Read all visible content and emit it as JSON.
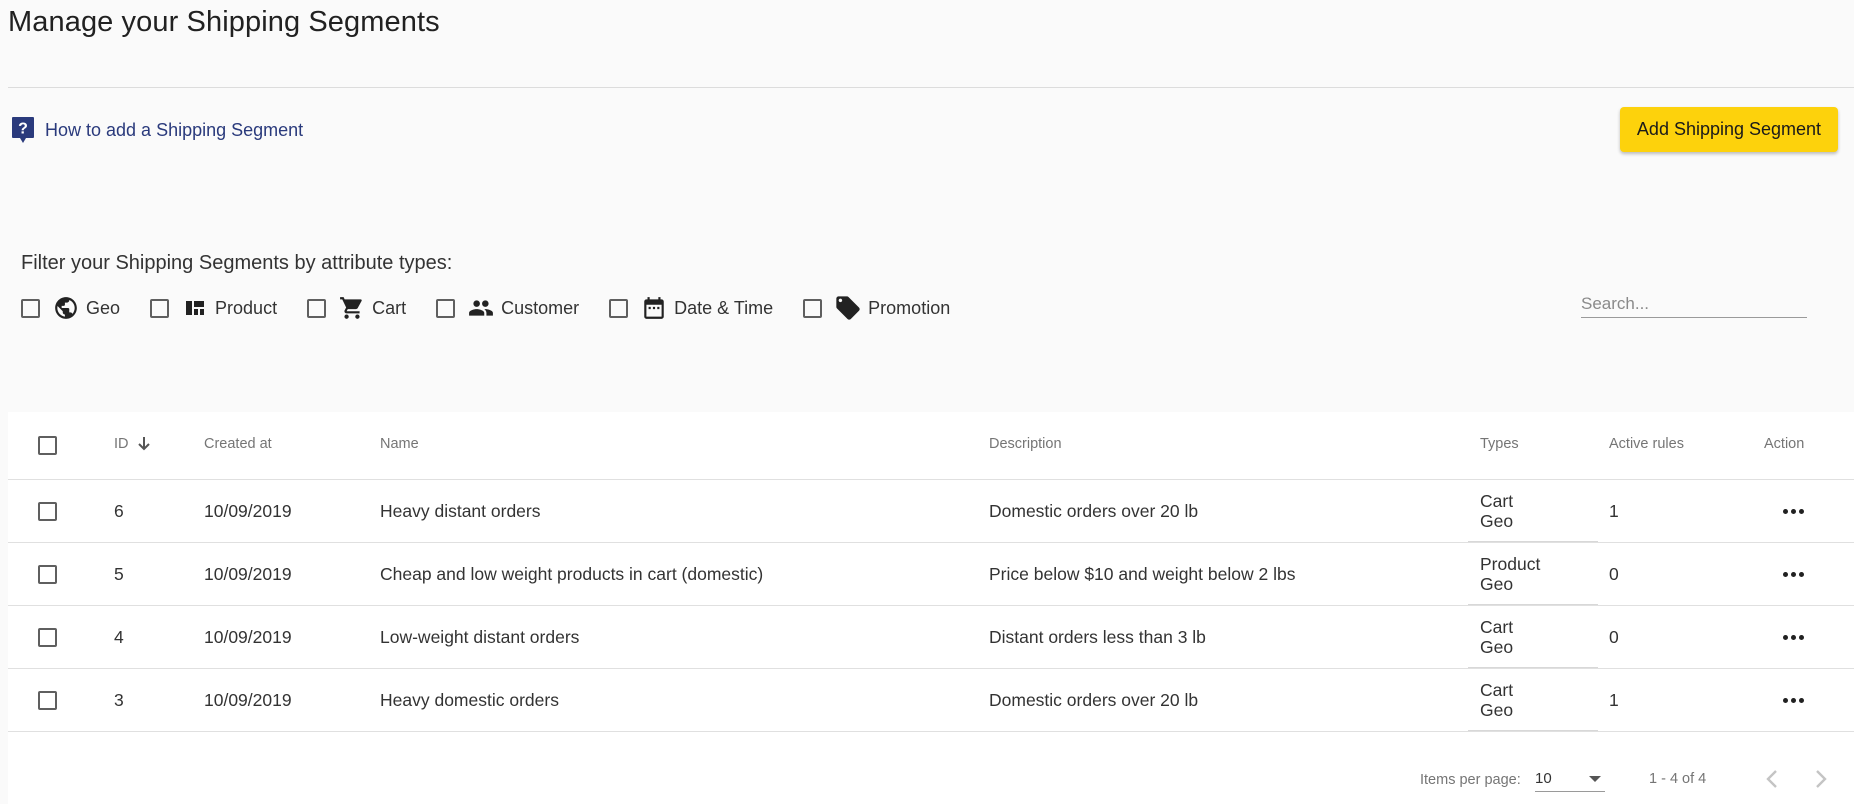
{
  "page": {
    "title": "Manage your Shipping Segments"
  },
  "help": {
    "label": "How to add a Shipping Segment",
    "icon": "help-question-icon"
  },
  "toolbar": {
    "add_label": "Add Shipping Segment",
    "accent": "#fdd20c"
  },
  "filters": {
    "heading": "Filter your Shipping Segments by attribute types:",
    "items": [
      {
        "label": "Geo",
        "icon": "globe-icon"
      },
      {
        "label": "Product",
        "icon": "dashboard-icon"
      },
      {
        "label": "Cart",
        "icon": "cart-icon"
      },
      {
        "label": "Customer",
        "icon": "people-icon"
      },
      {
        "label": "Date & Time",
        "icon": "calendar-icon"
      },
      {
        "label": "Promotion",
        "icon": "tag-icon"
      }
    ]
  },
  "search": {
    "placeholder": "Search...",
    "value": ""
  },
  "table": {
    "columns": {
      "id": "ID",
      "created": "Created at",
      "name": "Name",
      "description": "Description",
      "types": "Types",
      "active": "Active rules",
      "action": "Action"
    },
    "rows": [
      {
        "id": "6",
        "created": "10/09/2019",
        "name": "Heavy distant orders",
        "description": "Domestic orders over 20 lb",
        "types": [
          "Cart",
          "Geo"
        ],
        "active": "1"
      },
      {
        "id": "5",
        "created": "10/09/2019",
        "name": "Cheap and low weight products in cart (domestic)",
        "description": "Price below $10 and weight below 2 lbs",
        "types": [
          "Product",
          "Geo"
        ],
        "active": "0"
      },
      {
        "id": "4",
        "created": "10/09/2019",
        "name": "Low-weight distant orders",
        "description": "Distant orders less than 3 lb",
        "types": [
          "Cart",
          "Geo"
        ],
        "active": "0"
      },
      {
        "id": "3",
        "created": "10/09/2019",
        "name": "Heavy domestic orders",
        "description": "Domestic orders over 20 lb",
        "types": [
          "Cart",
          "Geo"
        ],
        "active": "1"
      }
    ]
  },
  "paginator": {
    "items_per_page_label": "Items per page:",
    "items_per_page": "10",
    "range": "1 - 4 of 4"
  }
}
